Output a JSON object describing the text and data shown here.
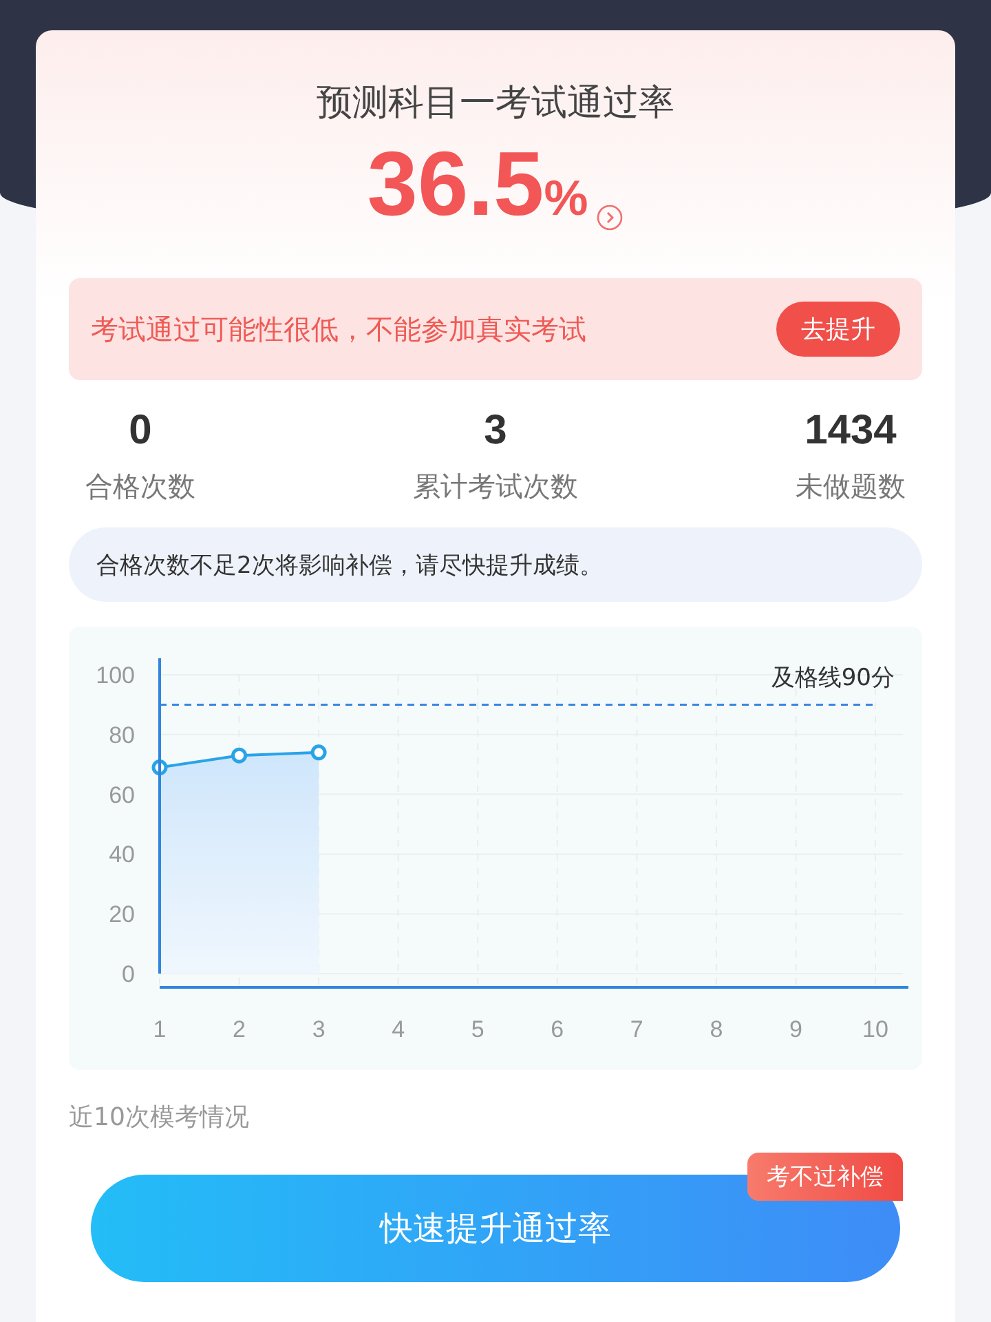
{
  "title": "预测科目一考试通过率",
  "rate": {
    "value": "36.5",
    "unit": "%"
  },
  "warning": {
    "text": "考试通过可能性很低，不能参加真实考试",
    "button": "去提升"
  },
  "stats": [
    {
      "value": "0",
      "label": "合格次数"
    },
    {
      "value": "3",
      "label": "累计考试次数"
    },
    {
      "value": "1434",
      "label": "未做题数"
    }
  ],
  "notice": "合格次数不足2次将影响补偿，请尽快提升成绩。",
  "chart": {
    "chart_data": {
      "type": "area",
      "categories": [
        "1",
        "2",
        "3",
        "4",
        "5",
        "6",
        "7",
        "8",
        "9",
        "10"
      ],
      "series": [
        {
          "color": "#29a3e8",
          "values": [
            69,
            73,
            74,
            null,
            null,
            null,
            null,
            null,
            null,
            null
          ]
        }
      ],
      "ylim": [
        0,
        100
      ],
      "yticks": [
        0,
        20,
        40,
        60,
        80,
        100
      ],
      "grid": true,
      "ref_lines": [
        {
          "axis": "y",
          "value": 90,
          "label": "及格线90分",
          "color": "#3a86e0"
        }
      ]
    }
  },
  "caption": "近10次模考情况",
  "action": {
    "label": "快速提升通过率",
    "badge": "考不过补偿"
  }
}
